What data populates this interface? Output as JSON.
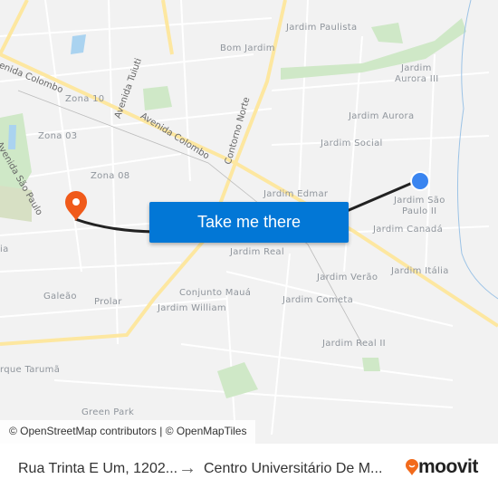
{
  "map": {
    "labels": [
      "Jardim Paulista",
      "Bom Jardim",
      "Jardim",
      "Aurora III",
      "Zona 10",
      "Jardim Aurora",
      "Zona 03",
      "Jardim Social",
      "Zona 08",
      "Jardim Edmar",
      "Jardim São",
      "Paulo II",
      "Jardim Canadá",
      "Jardim Real",
      "ia",
      "Jardim Itália",
      "Jardim Verão",
      "Conjunto Mauá",
      "Jardim Cometa",
      "Galeão",
      "Prolar",
      "Jardim William",
      "Jardim Real II",
      "rque Tarumã",
      "Green Park"
    ],
    "roads": [
      "Avenida Colombo",
      "Avenida Tuiuti",
      "Avenida Colombo",
      "Contorno Norte",
      "Avenida São Paulo"
    ],
    "origin_color": "#3a85f0",
    "destination_color": "#f05a1a",
    "route_color": "#222222"
  },
  "cta": {
    "label": "Take me there",
    "color": "#0277d6"
  },
  "attribution": "© OpenStreetMap contributors | © OpenMapTiles",
  "footer": {
    "from": "Rua Trinta E Um, 1202...",
    "arrow_icon": "arrow-right-icon",
    "to": "Centro Universitário De M...",
    "logo": "moovit",
    "logo_color": "#f26a1b"
  }
}
